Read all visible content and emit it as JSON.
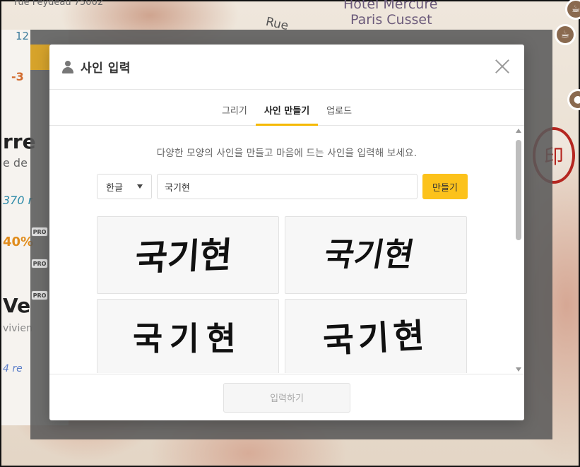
{
  "background": {
    "map_text_1": "Hôtel Mercure",
    "map_text_2": "Paris Cusset",
    "map_text_3": "Rue",
    "left_texts": [
      "rue Feydeau 75002",
      "12",
      "-3",
      "rre",
      "e de",
      "370 r",
      "40%",
      "Ve",
      "vivien",
      "4 re"
    ],
    "pro_badge": "PRO",
    "stamp_glyph": "印"
  },
  "modal": {
    "title": "사인 입력",
    "tabs": [
      {
        "label": "그리기",
        "active": false
      },
      {
        "label": "사인 만들기",
        "active": true
      },
      {
        "label": "업로드",
        "active": false
      }
    ],
    "description": "다양한 모양의 사인을 만들고 마음에 드는 사인을 입력해 보세요.",
    "language_select": {
      "selected": "한글"
    },
    "name_input": {
      "value": "국기현"
    },
    "make_button": "만들기",
    "signatures": [
      "국기현",
      "국기현",
      "국기현",
      "국기현"
    ],
    "submit_button": "입력하기"
  },
  "colors": {
    "accent": "#fcc21b",
    "tab_underline": "#f5b900",
    "overlay": "#5a5a5a"
  }
}
